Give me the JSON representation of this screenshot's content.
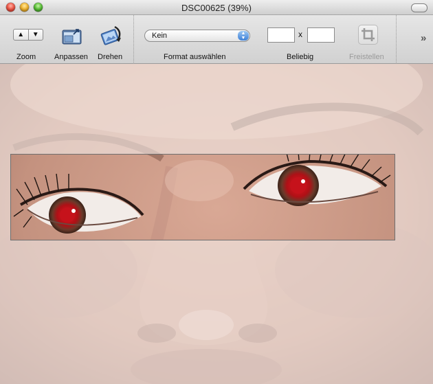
{
  "window": {
    "title": "DSC00625 (39%)"
  },
  "toolbar": {
    "zoom": {
      "label": "Zoom",
      "up": "▲",
      "down": "▼"
    },
    "fit": {
      "label": "Anpassen",
      "icon": "fit-window-icon"
    },
    "rotate": {
      "label": "Drehen",
      "icon": "rotate-icon"
    },
    "format": {
      "label": "Format auswählen",
      "value": "Kein"
    },
    "size": {
      "label": "Beliebig",
      "width": "",
      "height": "",
      "separator": "x"
    },
    "crop": {
      "label": "Freistellen",
      "icon": "crop-icon",
      "enabled": false
    },
    "overflow": {
      "glyph": "»"
    }
  },
  "colors": {
    "eye_red": "#c8131b",
    "skin": "#c89a88",
    "skin_faded": "#e3d3cb"
  }
}
